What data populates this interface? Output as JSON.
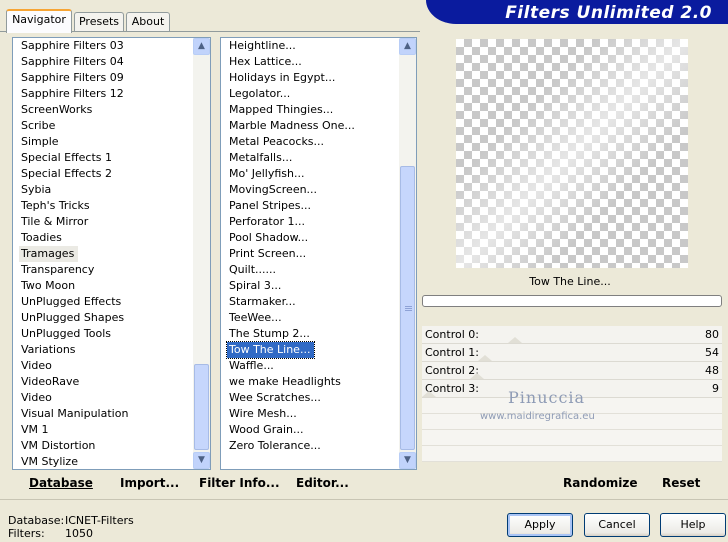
{
  "tabs": [
    {
      "label": "Navigator"
    },
    {
      "label": "Presets"
    },
    {
      "label": "About"
    }
  ],
  "banner": {
    "title": "Filters Unlimited 2.0"
  },
  "categories": [
    "Sapphire Filters 03",
    "Sapphire Filters 04",
    "Sapphire Filters 09",
    "Sapphire Filters 12",
    "ScreenWorks",
    "Scribe",
    "Simple",
    "Special Effects 1",
    "Special Effects 2",
    "Sybia",
    "Teph's Tricks",
    "Tile & Mirror",
    "Toadies",
    "Tramages",
    "Transparency",
    "Two Moon",
    "UnPlugged Effects",
    "UnPlugged Shapes",
    "UnPlugged Tools",
    "Variations",
    "Video",
    "VideoRave",
    "Video",
    "Visual Manipulation",
    "VM 1",
    "VM Distortion",
    "VM Stylize"
  ],
  "selected_category": "Tramages",
  "filters": [
    "Heightline...",
    "Hex Lattice...",
    "Holidays in Egypt...",
    "Legolator...",
    "Mapped Thingies...",
    "Marble Madness One...",
    "Metal Peacocks...",
    "Metalfalls...",
    "Mo' Jellyfish...",
    "MovingScreen...",
    "Panel Stripes...",
    "Perforator 1...",
    "Pool Shadow...",
    "Print Screen...",
    "Quilt......",
    "Spiral 3...",
    "Starmaker...",
    "TeeWee...",
    "The Stump 2...",
    "Tow The Line...",
    "Waffle...",
    "we make Headlights",
    "Wee Scratches...",
    "Wire Mesh...",
    "Wood Grain...",
    "Zero Tolerance..."
  ],
  "selected_filter": "Tow The Line...",
  "filter_title": "Tow The Line...",
  "controls": [
    {
      "label": "Control 0:",
      "value": "80"
    },
    {
      "label": "Control 1:",
      "value": "54"
    },
    {
      "label": "Control 2:",
      "value": "48"
    },
    {
      "label": "Control 3:",
      "value": "9"
    }
  ],
  "watermark": {
    "name": "Pinuccia",
    "url": "www.maidiregrafica.eu"
  },
  "toolbar": {
    "database": "Database",
    "import": "Import...",
    "filter_info": "Filter Info...",
    "editor": "Editor...",
    "randomize": "Randomize",
    "reset": "Reset"
  },
  "status": {
    "database_label": "Database:",
    "database_value": "ICNET-Filters",
    "filters_label": "Filters:",
    "filters_value": "1050"
  },
  "buttons": {
    "apply": "Apply",
    "cancel": "Cancel",
    "help": "Help"
  },
  "colors": {
    "banner": "#0a1b9e",
    "selection": "#316ac5",
    "tab_highlight": "#f7a534"
  }
}
